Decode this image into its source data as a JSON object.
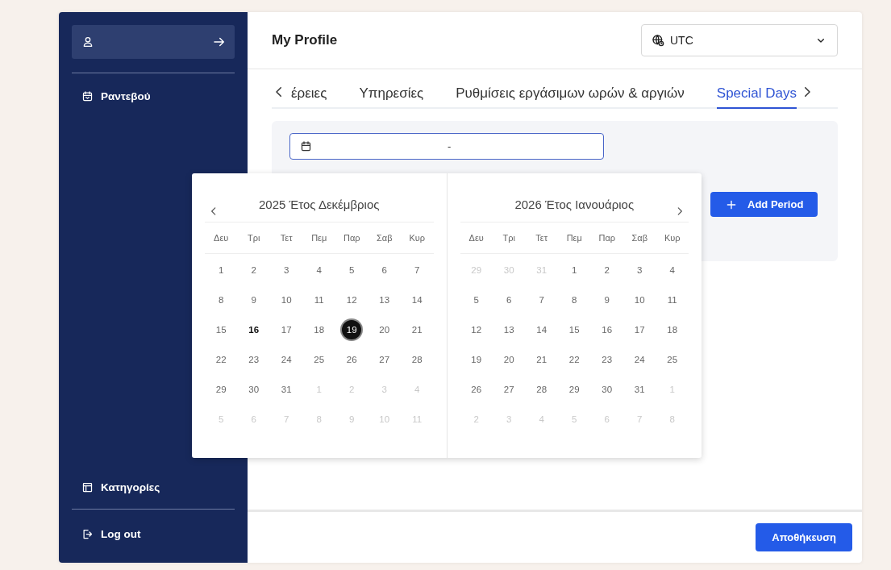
{
  "sidebar": {
    "top_items": [
      {
        "label": "Ραντεβού"
      }
    ],
    "bottom_items": [
      {
        "label": "Κατηγορίες"
      }
    ],
    "logout": "Log out"
  },
  "header": {
    "title": "My Profile",
    "timezone": "UTC"
  },
  "tabs": [
    {
      "label": "έρειες",
      "selected": false
    },
    {
      "label": "Υπηρεσίες",
      "selected": false
    },
    {
      "label": "Ρυθμίσεις εργάσιμων ωρών & αργιών",
      "selected": false
    },
    {
      "label": "Special Days",
      "selected": true
    }
  ],
  "date_range": {
    "separator": "-"
  },
  "add_button": "Add Period",
  "save_button": "Αποθήκευση",
  "date_picker": {
    "months": [
      {
        "title": "2025 Έτος Δεκέμβριος",
        "kind": "prev",
        "weekdays": [
          "Δευ",
          "Τρι",
          "Τετ",
          "Πεμ",
          "Παρ",
          "Σαβ",
          "Κυρ"
        ],
        "weeks": [
          [
            {
              "d": "1",
              "outside": false,
              "today": false,
              "selected": false
            },
            {
              "d": "2",
              "outside": false,
              "today": false,
              "selected": false
            },
            {
              "d": "3",
              "outside": false,
              "today": false,
              "selected": false
            },
            {
              "d": "4",
              "outside": false,
              "today": false,
              "selected": false
            },
            {
              "d": "5",
              "outside": false,
              "today": false,
              "selected": false
            },
            {
              "d": "6",
              "outside": false,
              "today": false,
              "selected": false
            },
            {
              "d": "7",
              "outside": false,
              "today": false,
              "selected": false
            }
          ],
          [
            {
              "d": "8",
              "outside": false,
              "today": false,
              "selected": false
            },
            {
              "d": "9",
              "outside": false,
              "today": false,
              "selected": false
            },
            {
              "d": "10",
              "outside": false,
              "today": false,
              "selected": false
            },
            {
              "d": "11",
              "outside": false,
              "today": false,
              "selected": false
            },
            {
              "d": "12",
              "outside": false,
              "today": false,
              "selected": false
            },
            {
              "d": "13",
              "outside": false,
              "today": false,
              "selected": false
            },
            {
              "d": "14",
              "outside": false,
              "today": false,
              "selected": false
            }
          ],
          [
            {
              "d": "15",
              "outside": false,
              "today": false,
              "selected": false
            },
            {
              "d": "16",
              "outside": false,
              "today": true,
              "selected": false
            },
            {
              "d": "17",
              "outside": false,
              "today": false,
              "selected": false
            },
            {
              "d": "18",
              "outside": false,
              "today": false,
              "selected": false
            },
            {
              "d": "19",
              "outside": false,
              "today": false,
              "selected": true
            },
            {
              "d": "20",
              "outside": false,
              "today": false,
              "selected": false
            },
            {
              "d": "21",
              "outside": false,
              "today": false,
              "selected": false
            }
          ],
          [
            {
              "d": "22",
              "outside": false,
              "today": false,
              "selected": false
            },
            {
              "d": "23",
              "outside": false,
              "today": false,
              "selected": false
            },
            {
              "d": "24",
              "outside": false,
              "today": false,
              "selected": false
            },
            {
              "d": "25",
              "outside": false,
              "today": false,
              "selected": false
            },
            {
              "d": "26",
              "outside": false,
              "today": false,
              "selected": false
            },
            {
              "d": "27",
              "outside": false,
              "today": false,
              "selected": false
            },
            {
              "d": "28",
              "outside": false,
              "today": false,
              "selected": false
            }
          ],
          [
            {
              "d": "29",
              "outside": false,
              "today": false,
              "selected": false
            },
            {
              "d": "30",
              "outside": false,
              "today": false,
              "selected": false
            },
            {
              "d": "31",
              "outside": false,
              "today": false,
              "selected": false
            },
            {
              "d": "1",
              "outside": true,
              "today": false,
              "selected": false
            },
            {
              "d": "2",
              "outside": true,
              "today": false,
              "selected": false
            },
            {
              "d": "3",
              "outside": true,
              "today": false,
              "selected": false
            },
            {
              "d": "4",
              "outside": true,
              "today": false,
              "selected": false
            }
          ],
          [
            {
              "d": "5",
              "outside": true,
              "today": false,
              "selected": false
            },
            {
              "d": "6",
              "outside": true,
              "today": false,
              "selected": false
            },
            {
              "d": "7",
              "outside": true,
              "today": false,
              "selected": false
            },
            {
              "d": "8",
              "outside": true,
              "today": false,
              "selected": false
            },
            {
              "d": "9",
              "outside": true,
              "today": false,
              "selected": false
            },
            {
              "d": "10",
              "outside": true,
              "today": false,
              "selected": false
            },
            {
              "d": "11",
              "outside": true,
              "today": false,
              "selected": false
            }
          ]
        ]
      },
      {
        "title": "2026 Έτος Ιανουάριος",
        "kind": "next",
        "weekdays": [
          "Δευ",
          "Τρι",
          "Τετ",
          "Πεμ",
          "Παρ",
          "Σαβ",
          "Κυρ"
        ],
        "weeks": [
          [
            {
              "d": "29",
              "outside": true,
              "today": false,
              "selected": false
            },
            {
              "d": "30",
              "outside": true,
              "today": false,
              "selected": false
            },
            {
              "d": "31",
              "outside": true,
              "today": false,
              "selected": false
            },
            {
              "d": "1",
              "outside": false,
              "today": false,
              "selected": false
            },
            {
              "d": "2",
              "outside": false,
              "today": false,
              "selected": false
            },
            {
              "d": "3",
              "outside": false,
              "today": false,
              "selected": false
            },
            {
              "d": "4",
              "outside": false,
              "today": false,
              "selected": false
            }
          ],
          [
            {
              "d": "5",
              "outside": false,
              "today": false,
              "selected": false
            },
            {
              "d": "6",
              "outside": false,
              "today": false,
              "selected": false
            },
            {
              "d": "7",
              "outside": false,
              "today": false,
              "selected": false
            },
            {
              "d": "8",
              "outside": false,
              "today": false,
              "selected": false
            },
            {
              "d": "9",
              "outside": false,
              "today": false,
              "selected": false
            },
            {
              "d": "10",
              "outside": false,
              "today": false,
              "selected": false
            },
            {
              "d": "11",
              "outside": false,
              "today": false,
              "selected": false
            }
          ],
          [
            {
              "d": "12",
              "outside": false,
              "today": false,
              "selected": false
            },
            {
              "d": "13",
              "outside": false,
              "today": false,
              "selected": false
            },
            {
              "d": "14",
              "outside": false,
              "today": false,
              "selected": false
            },
            {
              "d": "15",
              "outside": false,
              "today": false,
              "selected": false
            },
            {
              "d": "16",
              "outside": false,
              "today": false,
              "selected": false
            },
            {
              "d": "17",
              "outside": false,
              "today": false,
              "selected": false
            },
            {
              "d": "18",
              "outside": false,
              "today": false,
              "selected": false
            }
          ],
          [
            {
              "d": "19",
              "outside": false,
              "today": false,
              "selected": false
            },
            {
              "d": "20",
              "outside": false,
              "today": false,
              "selected": false
            },
            {
              "d": "21",
              "outside": false,
              "today": false,
              "selected": false
            },
            {
              "d": "22",
              "outside": false,
              "today": false,
              "selected": false
            },
            {
              "d": "23",
              "outside": false,
              "today": false,
              "selected": false
            },
            {
              "d": "24",
              "outside": false,
              "today": false,
              "selected": false
            },
            {
              "d": "25",
              "outside": false,
              "today": false,
              "selected": false
            }
          ],
          [
            {
              "d": "26",
              "outside": false,
              "today": false,
              "selected": false
            },
            {
              "d": "27",
              "outside": false,
              "today": false,
              "selected": false
            },
            {
              "d": "28",
              "outside": false,
              "today": false,
              "selected": false
            },
            {
              "d": "29",
              "outside": false,
              "today": false,
              "selected": false
            },
            {
              "d": "30",
              "outside": false,
              "today": false,
              "selected": false
            },
            {
              "d": "31",
              "outside": false,
              "today": false,
              "selected": false
            },
            {
              "d": "1",
              "outside": true,
              "today": false,
              "selected": false
            }
          ],
          [
            {
              "d": "2",
              "outside": true,
              "today": false,
              "selected": false
            },
            {
              "d": "3",
              "outside": true,
              "today": false,
              "selected": false
            },
            {
              "d": "4",
              "outside": true,
              "today": false,
              "selected": false
            },
            {
              "d": "5",
              "outside": true,
              "today": false,
              "selected": false
            },
            {
              "d": "6",
              "outside": true,
              "today": false,
              "selected": false
            },
            {
              "d": "7",
              "outside": true,
              "today": false,
              "selected": false
            },
            {
              "d": "8",
              "outside": true,
              "today": false,
              "selected": false
            }
          ]
        ]
      }
    ]
  }
}
